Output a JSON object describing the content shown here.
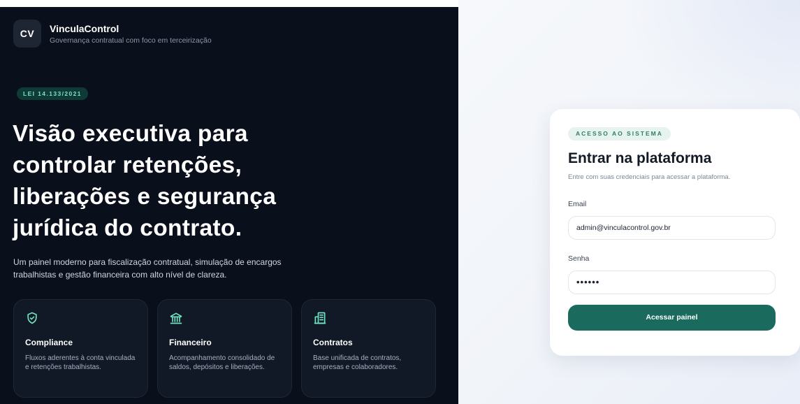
{
  "brand": {
    "initials": "CV",
    "name": "VinculaControl",
    "tagline": "Governança contratual com foco em terceirização"
  },
  "hero": {
    "badge": "LEI 14.133/2021",
    "headline_lines": [
      "Visão executiva para",
      "controlar retenções,",
      "liberações e segurança",
      "jurídica do contrato."
    ],
    "lead": "Um painel moderno para fiscalização contratual, simulação de encargos trabalhistas e gestão financeira com alto nível de clareza."
  },
  "features": [
    {
      "icon": "shield-check-icon",
      "title": "Compliance",
      "description": "Fluxos aderentes à conta vinculada e retenções trabalhistas."
    },
    {
      "icon": "bank-icon",
      "title": "Financeiro",
      "description": "Acompanhamento consolidado de saldos, depósitos e liberações."
    },
    {
      "icon": "building-icon",
      "title": "Contratos",
      "description": "Base unificada de contratos, empresas e colaboradores."
    }
  ],
  "login": {
    "badge": "ACESSO AO SISTEMA",
    "title": "Entrar na plataforma",
    "subtitle": "Entre com suas credenciais para acessar a plataforma.",
    "email_label": "Email",
    "email_value": "admin@vinculacontrol.gov.br",
    "password_label": "Senha",
    "password_value": "••••••",
    "submit_label": "Acessar painel"
  },
  "colors": {
    "left_bg": "#0a0f1c",
    "accent": "#1a6b5e",
    "badge_text": "#7fe0c6",
    "icon_accent": "#6fe3c2"
  }
}
